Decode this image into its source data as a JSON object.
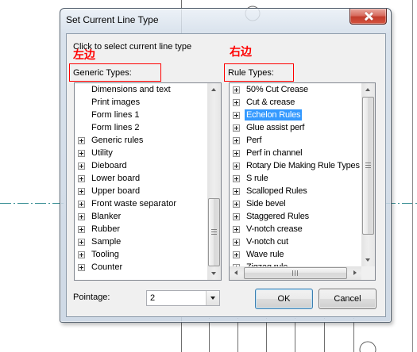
{
  "window": {
    "title": "Set Current Line Type"
  },
  "instructions": "Click to select current line type",
  "annotations": {
    "left": "左边",
    "right": "右边"
  },
  "generic_types": {
    "label": "Generic Types:",
    "items": [
      {
        "label": "Dimensions and text",
        "expandable": false
      },
      {
        "label": "Print images",
        "expandable": false
      },
      {
        "label": "Form lines 1",
        "expandable": false
      },
      {
        "label": "Form lines 2",
        "expandable": false
      },
      {
        "label": "Generic rules",
        "expandable": true
      },
      {
        "label": "Utility",
        "expandable": true
      },
      {
        "label": "Dieboard",
        "expandable": true
      },
      {
        "label": "Lower board",
        "expandable": true
      },
      {
        "label": "Upper board",
        "expandable": true
      },
      {
        "label": "Front waste separator",
        "expandable": true
      },
      {
        "label": "Blanker",
        "expandable": true
      },
      {
        "label": "Rubber",
        "expandable": true
      },
      {
        "label": "Sample",
        "expandable": true
      },
      {
        "label": "Tooling",
        "expandable": true
      },
      {
        "label": "Counter",
        "expandable": true
      }
    ]
  },
  "rule_types": {
    "label": "Rule Types:",
    "selected_index": 2,
    "items": [
      {
        "label": "50% Cut Crease",
        "expandable": true
      },
      {
        "label": "Cut & crease",
        "expandable": true
      },
      {
        "label": "Echelon Rules",
        "expandable": true
      },
      {
        "label": "Glue assist perf",
        "expandable": true
      },
      {
        "label": "Perf",
        "expandable": true
      },
      {
        "label": "Perf in channel",
        "expandable": true
      },
      {
        "label": "Rotary Die Making Rule Types",
        "expandable": true
      },
      {
        "label": "S rule",
        "expandable": true
      },
      {
        "label": "Scalloped Rules",
        "expandable": true
      },
      {
        "label": "Side bevel",
        "expandable": true
      },
      {
        "label": "Staggered Rules",
        "expandable": true
      },
      {
        "label": "V-notch crease",
        "expandable": true
      },
      {
        "label": "V-notch cut",
        "expandable": true
      },
      {
        "label": "Wave rule",
        "expandable": true
      },
      {
        "label": "Zigzag rule",
        "expandable": true
      }
    ]
  },
  "pointage": {
    "label": "Pointage:",
    "value": "2"
  },
  "buttons": {
    "ok": "OK",
    "cancel": "Cancel"
  },
  "icons": {
    "close": "close-icon",
    "expand": "expand-icon",
    "dropdown": "chevron-down-icon",
    "scroll_up": "arrow-up-icon",
    "scroll_down": "arrow-down-icon",
    "scroll_left": "arrow-left-icon",
    "scroll_right": "arrow-right-icon"
  },
  "colors": {
    "selection": "#3399ff",
    "annotation": "#ff0000",
    "close_button": "#c7463a",
    "centerline": "#3a8f95"
  }
}
